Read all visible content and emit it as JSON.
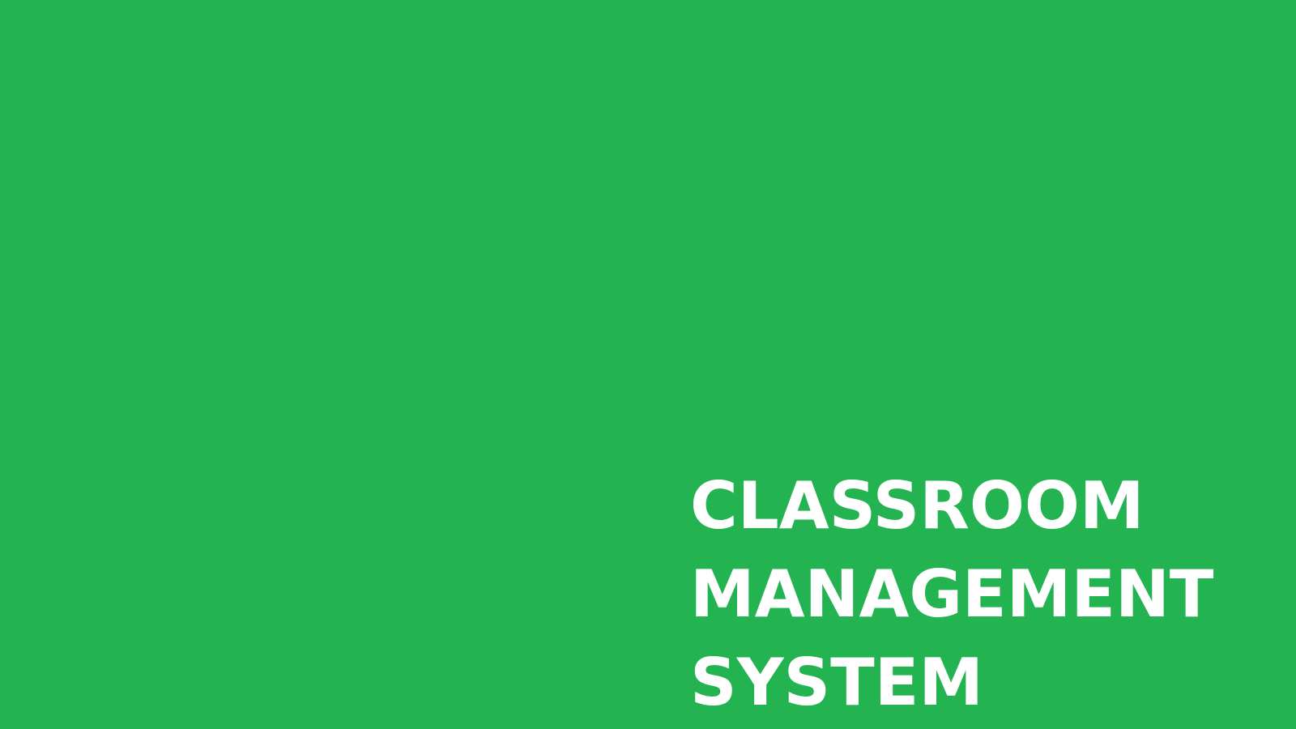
{
  "splash": {
    "title_lines": [
      "CLASSROOM",
      "MANAGEMENT",
      "SYSTEM"
    ],
    "background_color": "#24b351",
    "text_color": "#ffffff"
  }
}
